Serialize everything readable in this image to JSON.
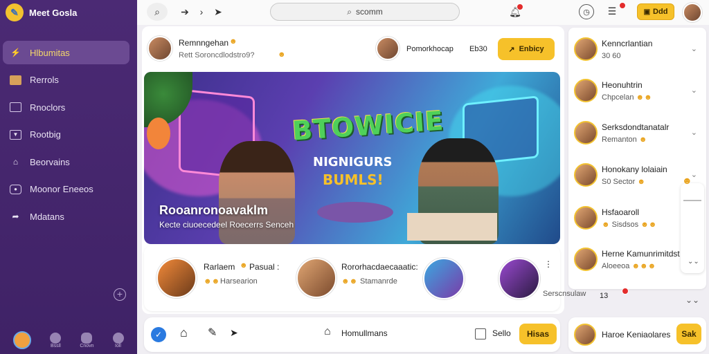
{
  "app": {
    "name": "Meet Gosla"
  },
  "sidebar": {
    "items": [
      {
        "label": "Hlbumitas",
        "icon": "lightning-icon",
        "active": true
      },
      {
        "label": "Rerrols",
        "icon": "image-icon",
        "active": false
      },
      {
        "label": "Rnoclors",
        "icon": "calendar-icon",
        "active": false
      },
      {
        "label": "Rootbig",
        "icon": "bookmark-icon",
        "active": false
      },
      {
        "label": "Beorvains",
        "icon": "home-icon",
        "active": false
      },
      {
        "label": "Moonor Eneeos",
        "icon": "record-icon",
        "active": false
      },
      {
        "label": "Mdatans",
        "icon": "share-icon",
        "active": false
      }
    ],
    "bottom": [
      "",
      "Bssll",
      "Cnovn",
      "Ioll"
    ]
  },
  "topbar": {
    "search_text": "scomm",
    "cta_label": "Ddd"
  },
  "post": {
    "author": "Remnngehan",
    "subtitle": "Rett Soroncdlodstro9?",
    "meta_name": "Pomorkhocap",
    "meta_count": "Eb30",
    "follow_label": "Enbicy"
  },
  "hero": {
    "logo_text": "BTOWICIE",
    "logo_sub": "",
    "sign1": "NIGNIGURS",
    "sign2": "BUMLS!",
    "caption": "Rooanronoavaklm",
    "caption_sub": "Kecte ciuoecedeel Roecerrs Senceh"
  },
  "people": [
    {
      "name": "Rarlaem",
      "role": "Pasual :",
      "sub": "Harsearion"
    },
    {
      "name": "Rororhacdaecaaatic:",
      "role": "",
      "sub": "Stamanrde"
    }
  ],
  "people_extra_label": "Serscnsulaw",
  "people_extra_count": "13",
  "bottom_bar": {
    "center_label": "Homullmans",
    "right_text": "Sello",
    "action_label": "Hisas"
  },
  "right_list": [
    {
      "name": "Kenncrlantian",
      "sub": "30 60"
    },
    {
      "name": "Heonuhtrin",
      "sub": "Chpcelan"
    },
    {
      "name": "Serksdondtanatalr",
      "sub": "Remanton"
    },
    {
      "name": "Honokany lolaiain",
      "sub": "S0 Sector"
    },
    {
      "name": "Hsfaoaroll",
      "sub": "Sisdsos"
    },
    {
      "name": "Herne Kamunrimitdst",
      "sub": "Aloeeoa"
    }
  ],
  "right_bottom": {
    "name": "Haroe Keniaolares",
    "action_label": "Sak"
  },
  "colors": {
    "sidebar": "#4b2a74",
    "accent": "#f6c12a",
    "badge": "#e32c2c"
  }
}
